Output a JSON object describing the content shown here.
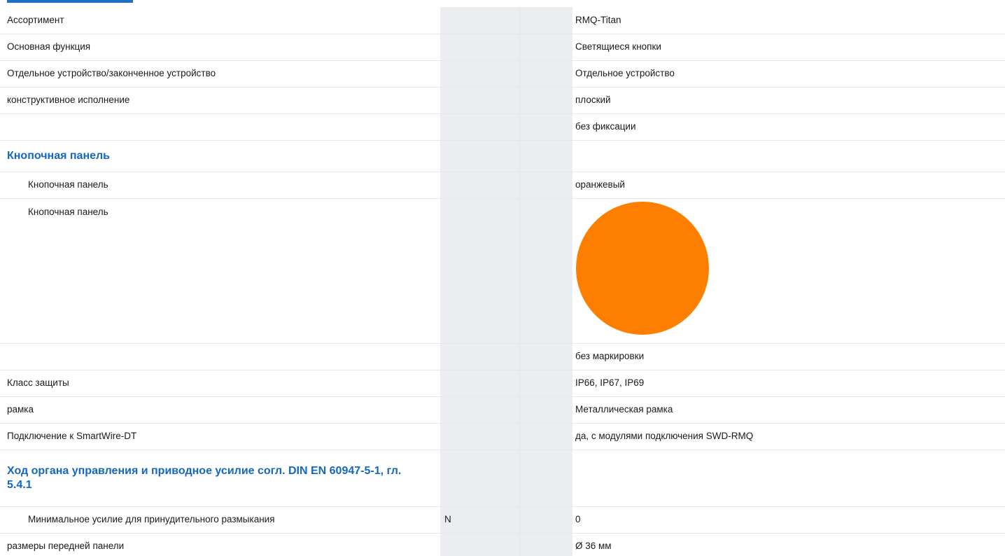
{
  "rows_top": [
    {
      "label": "Ассортимент",
      "unit": "",
      "value": "RMQ-Titan"
    },
    {
      "label": "Основная функция",
      "unit": "",
      "value": "Светящиеся кнопки"
    },
    {
      "label": "Отдельное устройство/законченное устройство",
      "unit": "",
      "value": "Отдельное устройство"
    },
    {
      "label": "конструктивное исполнение",
      "unit": "",
      "value": "плоский"
    },
    {
      "label": "",
      "unit": "",
      "value": "без фиксации"
    }
  ],
  "section_button": {
    "title": "Кнопочная панель",
    "color_label": "Кнопочная панель",
    "color_value": "оранжевый",
    "swatch_label": "Кнопочная панель",
    "swatch_color": "#fe7f00"
  },
  "rows_mid": [
    {
      "label": "",
      "unit": "",
      "value": "без маркировки"
    },
    {
      "label": "Класс защиты",
      "unit": "",
      "value": "IP66, IP67, IP69"
    },
    {
      "label": "рамка",
      "unit": "",
      "value": "Металлическая рамка"
    },
    {
      "label": "Подключение к SmartWire-DT",
      "unit": "",
      "value": "да, с модулями подключения SWD-RMQ"
    }
  ],
  "section_force": {
    "title": "Ход органа управления и приводное усилие согл. DIN EN 60947-5-1, гл. 5.4.1",
    "row": {
      "label": "Минимальное усилие для принудительного размыкания",
      "unit": "N",
      "value": "0"
    }
  },
  "rows_bottom": [
    {
      "label": "размеры передней панели",
      "unit": "",
      "value": "Ø 36 мм"
    }
  ]
}
